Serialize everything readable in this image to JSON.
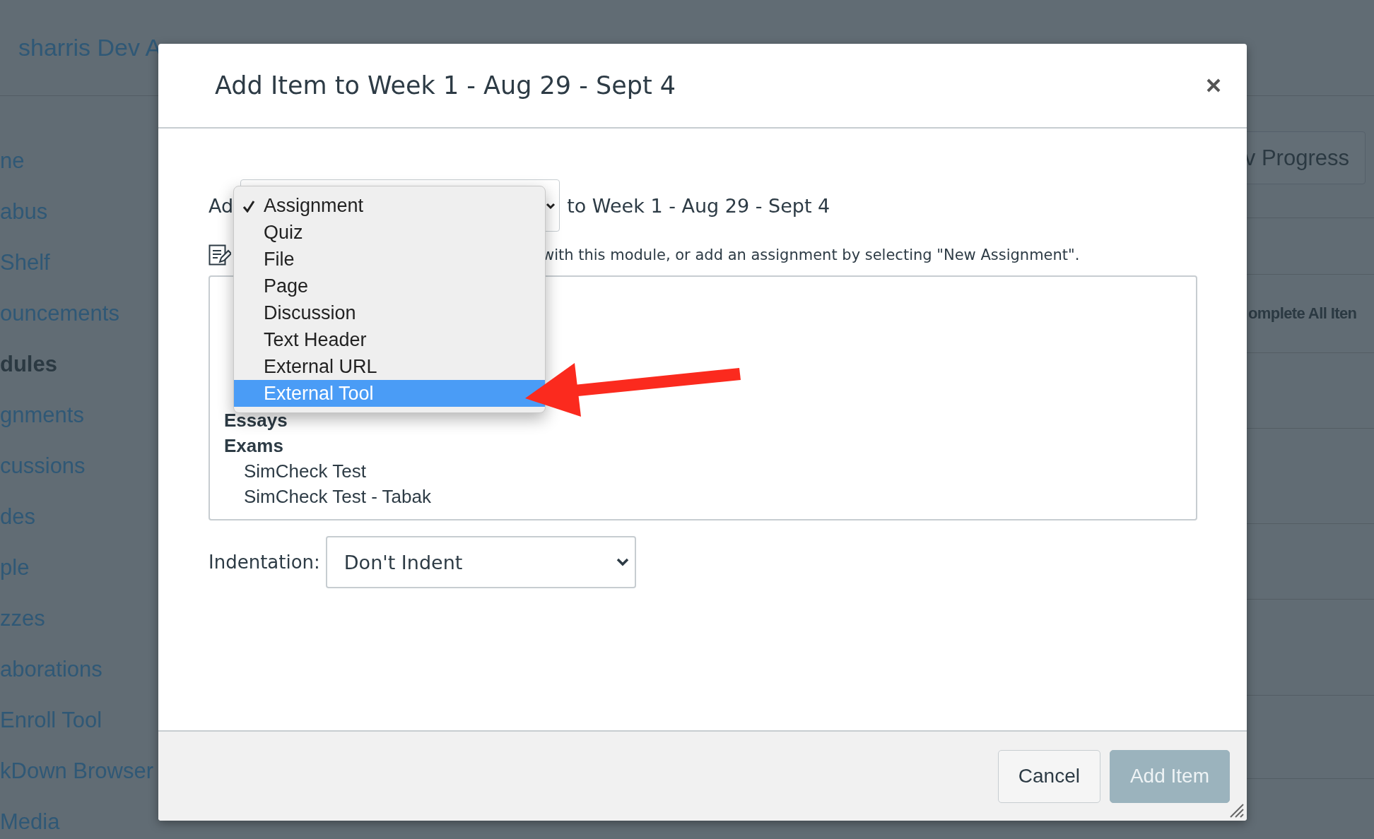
{
  "background_page": {
    "breadcrumb": "sharris Dev A",
    "sidebar": {
      "items": [
        {
          "label": "ne",
          "selected": false
        },
        {
          "label": "abus",
          "selected": false
        },
        {
          "label": "Shelf",
          "selected": false
        },
        {
          "label": "ouncements",
          "selected": false
        },
        {
          "label": "dules",
          "selected": true
        },
        {
          "label": "gnments",
          "selected": false
        },
        {
          "label": "cussions",
          "selected": false
        },
        {
          "label": "des",
          "selected": false
        },
        {
          "label": "ple",
          "selected": false
        },
        {
          "label": "zzes",
          "selected": false
        },
        {
          "label": "aborations",
          "selected": false
        },
        {
          "label": " Enroll Tool",
          "selected": false
        },
        {
          "label": "kDown Browser",
          "selected": false
        },
        {
          "label": "Media",
          "selected": false
        }
      ]
    },
    "progress_button": "v Progress",
    "complete_all_button": "omplete All Iten"
  },
  "dialog": {
    "title": "Add Item to Week 1 - Aug 29 - Sept 4",
    "add_label": "Ad",
    "add_suffix": "to Week 1 - Aug 29 - Sept 4",
    "item_type_menu": [
      {
        "label": "Assignment",
        "checked": true,
        "selected": false
      },
      {
        "label": "Quiz",
        "checked": false,
        "selected": false
      },
      {
        "label": "File",
        "checked": false,
        "selected": false
      },
      {
        "label": "Page",
        "checked": false,
        "selected": false
      },
      {
        "label": "Discussion",
        "checked": false,
        "selected": false
      },
      {
        "label": "Text Header",
        "checked": false,
        "selected": false
      },
      {
        "label": "External URL",
        "checked": false,
        "selected": false
      },
      {
        "label": "External Tool",
        "checked": false,
        "selected": true
      }
    ],
    "description": "with this module, or add an assignment by selecting \"New Assignment\".",
    "assignment_list": [
      {
        "text": "Essays",
        "kind": "group"
      },
      {
        "text": "Exams",
        "kind": "group"
      },
      {
        "text": "SimCheck Test",
        "kind": "item"
      },
      {
        "text": "SimCheck Test - Tabak",
        "kind": "item"
      }
    ],
    "indentation": {
      "label": "Indentation:",
      "value": "Don't Indent"
    },
    "buttons": [
      {
        "label": "Cancel",
        "kind": "secondary"
      },
      {
        "label": "Add Item",
        "kind": "primary",
        "disabled": true
      }
    ]
  }
}
